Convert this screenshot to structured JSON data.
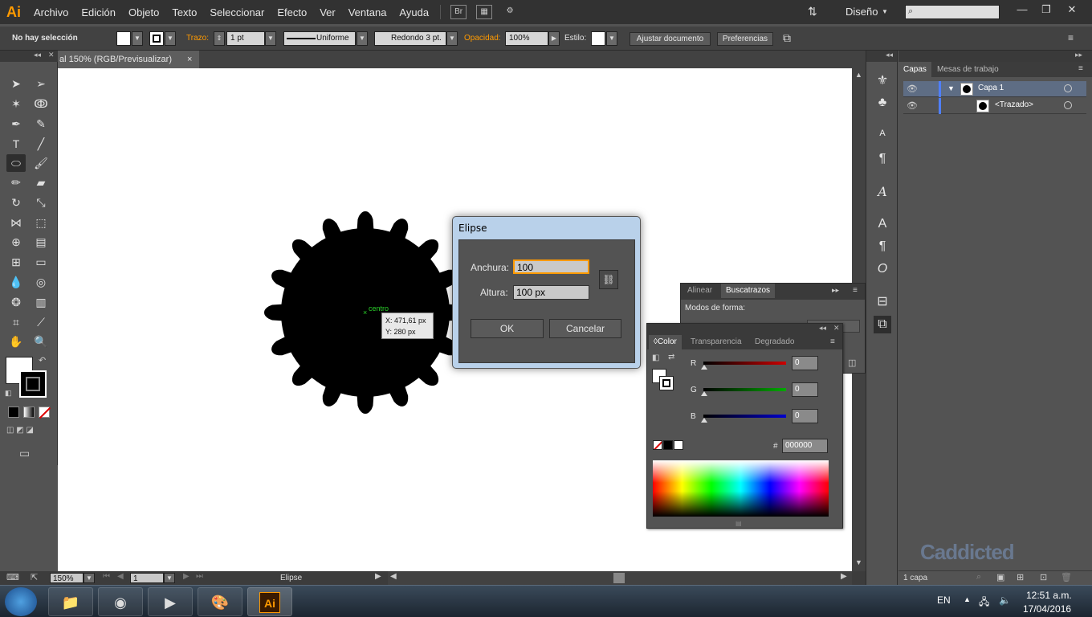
{
  "app": {
    "logo": "Ai",
    "workspace": "Diseño"
  },
  "menu": [
    "Archivo",
    "Edición",
    "Objeto",
    "Texto",
    "Seleccionar",
    "Efecto",
    "Ver",
    "Ventana",
    "Ayuda"
  ],
  "menubar_icons": {
    "bridge": "Br"
  },
  "control": {
    "selection": "No hay selección",
    "stroke_label": "Trazo:",
    "stroke_weight": "1 pt",
    "profile": "Uniforme",
    "brush": "Redondo 3 pt.",
    "opacity_label": "Opacidad:",
    "opacity": "100%",
    "style_label": "Estilo:",
    "fit_button": "Ajustar documento",
    "prefs_button": "Preferencias"
  },
  "document": {
    "tab": "al 150% (RGB/Previsualizar)",
    "close": "×"
  },
  "status": {
    "zoom": "150%",
    "artboard": "1",
    "tool": "Elipse"
  },
  "canvas": {
    "center_label": "centro",
    "center_mark": "×",
    "tip_x": "X: 471,61 px",
    "tip_y": "Y: 280 px"
  },
  "dialog": {
    "title": "Elipse",
    "width_label": "Anchura:",
    "width_value": "100",
    "height_label": "Altura:",
    "height_value": "100 px",
    "ok": "OK",
    "cancel": "Cancelar"
  },
  "align_panel": {
    "tabs": [
      "Alinear",
      "Buscatrazos"
    ],
    "modes_label": "Modos de forma:"
  },
  "color_panel": {
    "tabs": [
      "Color",
      "Transparencia",
      "Degradado"
    ],
    "r_label": "R",
    "r_value": "0",
    "g_label": "G",
    "g_value": "0",
    "b_label": "B",
    "b_value": "0",
    "hex_label": "#",
    "hex_value": "000000",
    "colors": {
      "r": "#cc0000",
      "g": "#00aa00",
      "b": "#0000cc"
    }
  },
  "layers": {
    "tabs": [
      "Capas",
      "Mesas de trabajo"
    ],
    "rows": [
      {
        "name": "Capa 1"
      },
      {
        "name": "<Trazado>"
      }
    ],
    "footer": "1 capa"
  },
  "watermark": "Caddicted",
  "taskbar": {
    "lang": "EN",
    "time": "12:51 a.m.",
    "date": "17/04/2016",
    "ai_label": "Ai"
  }
}
